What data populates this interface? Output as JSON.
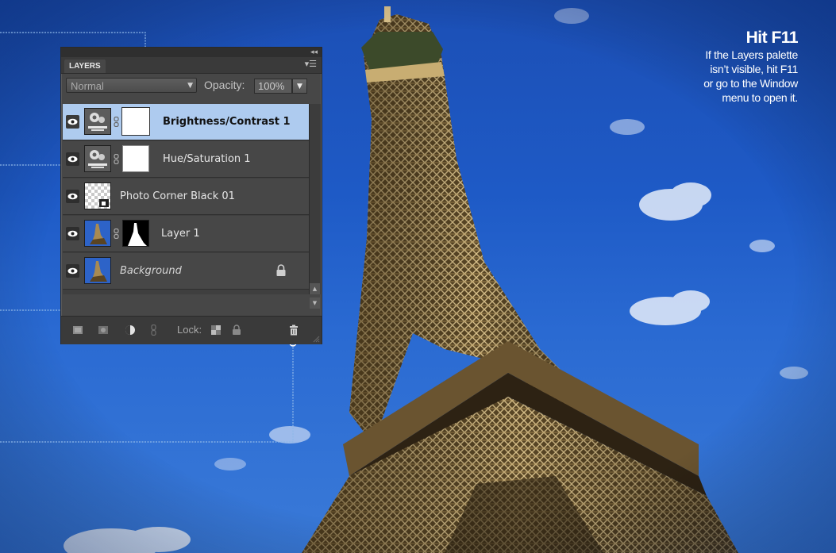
{
  "callout": {
    "title": "Hit F11",
    "lines": [
      "If the Layers palette",
      "isn’t visible, hit F11",
      "or go to the Window",
      "menu to open it."
    ]
  },
  "panel": {
    "tab_label": "LAYERS",
    "blend_mode": "Normal",
    "opacity_label": "Opacity:",
    "opacity_value": "100%",
    "lock_label": "Lock:",
    "layers": [
      {
        "name": "Brightness/Contrast 1",
        "selected": true,
        "kind": "adjustment",
        "thumb_icon": "gear-icon"
      },
      {
        "name": "Hue/Saturation 1",
        "selected": false,
        "kind": "adjustment",
        "thumb_icon": "gear-icon"
      },
      {
        "name": "Photo Corner Black 01",
        "selected": false,
        "kind": "transparent"
      },
      {
        "name": "Layer 1",
        "selected": false,
        "kind": "photo-with-mask"
      },
      {
        "name": "Background",
        "selected": false,
        "kind": "background",
        "locked": true
      }
    ]
  },
  "colors": {
    "sky": "#1e5ac6",
    "panel_bg": "#474747",
    "selected_row": "#aecbef",
    "guide_line": "#8fb8e8"
  }
}
